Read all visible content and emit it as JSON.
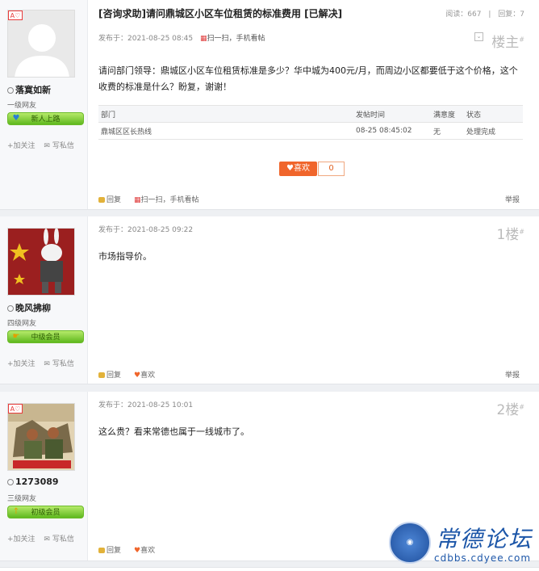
{
  "thread": {
    "title": "[咨询求助]请问鼎城区小区车位租赁的标准费用 [已解决]",
    "views_label": "阅读：667",
    "replies_label": "回复：7",
    "sep": "|"
  },
  "posts": [
    {
      "user": {
        "name": "落寞如新",
        "level": "一级网友",
        "medal": "新人上路",
        "follow": "+加关注",
        "message": "写私信"
      },
      "meta": "发布于：2021-08-25 08:45",
      "scan": "扫一扫，手机看帖",
      "floor": "楼主",
      "content": "请问部门领导：鼎城区小区车位租赁标准是多少？华中城为400元/月，而周边小区都要低于这个价格，这个收费的标准是什么？盼复，谢谢！",
      "table": {
        "headers": [
          "部门",
          "发帖时间",
          "满意度",
          "状态"
        ],
        "row": [
          "鼎城区区长热线",
          "08-25 08:45:02",
          "无",
          "处理完成"
        ]
      },
      "like_label": "喜欢",
      "like_count": "0",
      "reply": "回复",
      "report": "举报"
    },
    {
      "user": {
        "name": "晚风拂柳",
        "level": "四级网友",
        "medal": "中级会员",
        "follow": "+加关注",
        "message": "写私信"
      },
      "meta": "发布于：2021-08-25 09:22",
      "floor": "1楼",
      "content": "市场指导价。",
      "reply": "回复",
      "like": "喜欢",
      "report": "举报"
    },
    {
      "user": {
        "name": "1273089",
        "level": "三级网友",
        "medal": "初级会员",
        "follow": "+加关注",
        "message": "写私信"
      },
      "meta": "发布于：2021-08-25 10:01",
      "floor": "2楼",
      "content": "这么贵？看来常德也属于一线城市了。",
      "reply": "回复",
      "like": "喜欢"
    }
  ],
  "watermark": {
    "title": "常德论坛",
    "url": "cdbbs.cdyee.com"
  },
  "colors": {
    "accent": "#f0652b",
    "medal_green": "#5fb81e",
    "brand_blue": "#1c56a8"
  }
}
